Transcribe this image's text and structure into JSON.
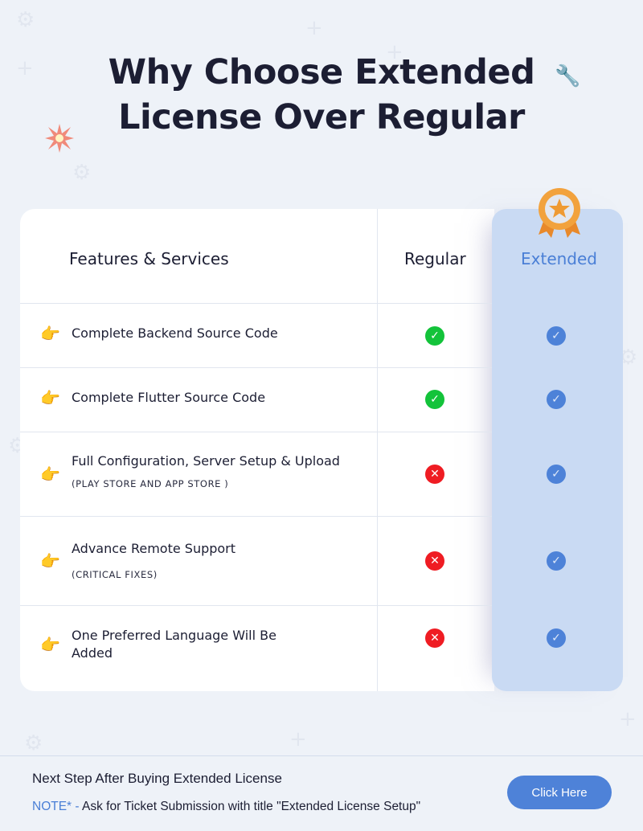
{
  "header": {
    "title_line1": "Why Choose Extended",
    "title_line2": "License Over Regular"
  },
  "table": {
    "columns": {
      "features": "Features & Services",
      "regular": "Regular",
      "extended": "Extended"
    },
    "rows": [
      {
        "label": "Complete Backend Source Code",
        "sub": "",
        "regular": "included",
        "extended": "included"
      },
      {
        "label": "Complete Flutter Source Code",
        "sub": "",
        "regular": "included",
        "extended": "included"
      },
      {
        "label": "Full Configuration, Server Setup & Upload",
        "sub": "(PLAY STORE AND APP STORE )",
        "regular": "not-included",
        "extended": "included"
      },
      {
        "label": "Advance Remote Support",
        "sub": "(CRITICAL FIXES)",
        "regular": "not-included",
        "extended": "included"
      },
      {
        "label": "One Preferred Language Will Be Added",
        "sub": "",
        "regular": "not-included",
        "extended": "included"
      }
    ],
    "icons": {
      "row_marker": "👉",
      "check": "✓",
      "cross": "✕"
    }
  },
  "footer": {
    "title": "Next Step After Buying Extended License",
    "note_prefix": "NOTE* - ",
    "note_text": "Ask for Ticket Submission with title \"Extended License Setup\"",
    "button_label": "Click Here"
  },
  "colors": {
    "accent": "#4e82d8",
    "regular_yes": "#13c33a",
    "regular_no": "#ef1c23",
    "extended_col": "#c9daf3"
  }
}
